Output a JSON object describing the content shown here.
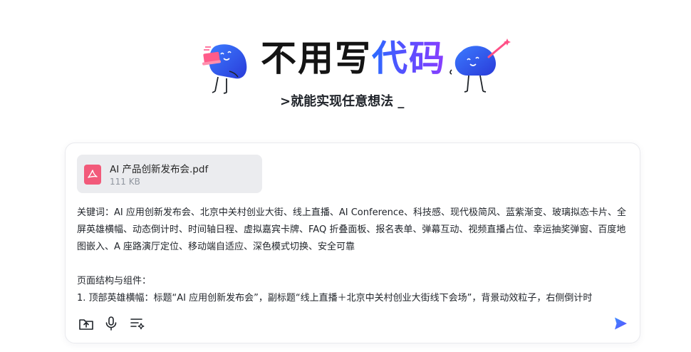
{
  "hero": {
    "title_part1": "不用写",
    "title_part2": "代码",
    "subtitle": ">就能实现任意想法 _"
  },
  "attachment": {
    "file_name": "AI 产品创新发布会.pdf",
    "file_size": "111 KB",
    "icon": "pdf-icon"
  },
  "prompt": {
    "text": "关键词：AI 应用创新发布会、北京中关村创业大街、线上直播、AI Conference、科技感、现代极简风、蓝紫渐变、玻璃拟态卡片、全屏英雄横幅、动态倒计时、时间轴日程、虚拟嘉宾卡牌、FAQ 折叠面板、报名表单、弹幕互动、视频直播占位、幸运抽奖弹窗、百度地图嵌入、A 座路演厅定位、移动端自适应、深色模式切换、安全可靠\n\n页面结构与组件：\n1. 顶部英雄横幅：标题“AI 应用创新发布会”，副标题“线上直播＋北京中关村创业大街线下会场”，背景动效粒子，右侧倒计时"
  },
  "toolbar": {
    "icons": [
      "upload-icon",
      "microphone-icon",
      "list-settings-icon",
      "send-icon"
    ]
  },
  "colors": {
    "accent_gradient_start": "#2b6bff",
    "accent_gradient_end": "#8a3dff",
    "send": "#4f6bff",
    "pdf": "#f25a7a",
    "chip_bg": "#ebecef"
  }
}
